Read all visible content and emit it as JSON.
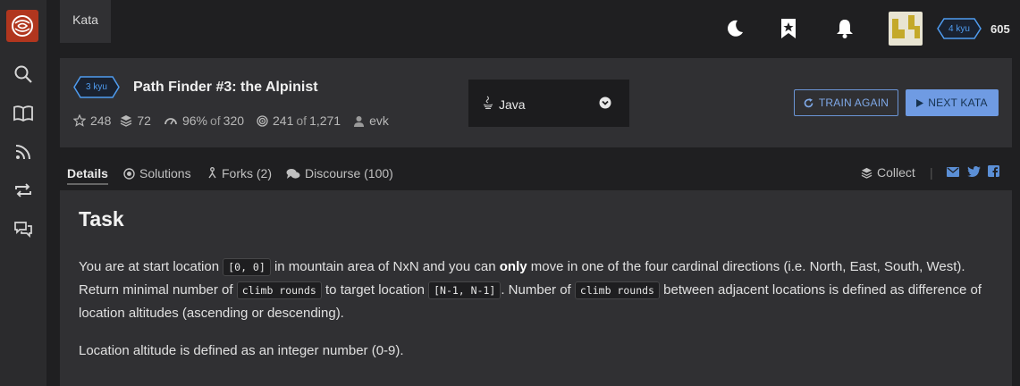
{
  "nav": {
    "breadcrumb": "Kata"
  },
  "user": {
    "rank": "4 kyu",
    "honor": "605"
  },
  "kata": {
    "rank": "3 kyu",
    "title": "Path Finder #3: the Alpinist",
    "stars": "248",
    "collections": "72",
    "satisfaction": "96%",
    "of_label": "of",
    "votes": "320",
    "completed": "241",
    "attempts": "1,271",
    "author": "evk"
  },
  "language": {
    "selected": "Java"
  },
  "actions": {
    "train_again": "TRAIN AGAIN",
    "next_kata": "NEXT KATA"
  },
  "tabs": {
    "details": "Details",
    "solutions": "Solutions",
    "forks": "Forks (2)",
    "discourse": "Discourse (100)",
    "collect": "Collect"
  },
  "description": {
    "heading": "Task",
    "p1_a": "You are at start location",
    "p1_code1": "[0, 0]",
    "p1_b": "in mountain area of NxN and you can",
    "p1_bold": "only",
    "p1_c": "move in one of the four cardinal directions (i.e. North, East, South, West).",
    "p1_d": "Return minimal number of",
    "p1_code2": "climb rounds",
    "p1_e": "to target location",
    "p1_code3": "[N-1, N-1]",
    "p1_f": ". Number of",
    "p1_code4": "climb rounds",
    "p1_g": "between adjacent locations is defined as",
    "p1_h": "difference of location altitudes (ascending or descending).",
    "p2": "Location altitude is defined as an integer number (0-9)."
  },
  "colors": {
    "accent": "#6f9be3",
    "logo": "#b1361e",
    "rank_blue": "#4f9cf0"
  },
  "icons": [
    "codewars-logo-icon",
    "search-icon",
    "book-icon",
    "rss-icon",
    "repeat-icon",
    "chat-icon",
    "moon-icon",
    "bookmark-star-icon",
    "bell-icon",
    "star-icon",
    "layers-icon",
    "gauge-icon",
    "target-icon",
    "user-icon",
    "java-icon",
    "chevron-down-icon",
    "refresh-icon",
    "play-icon",
    "fork-icon",
    "comments-icon",
    "mail-icon",
    "twitter-icon",
    "facebook-icon"
  ]
}
